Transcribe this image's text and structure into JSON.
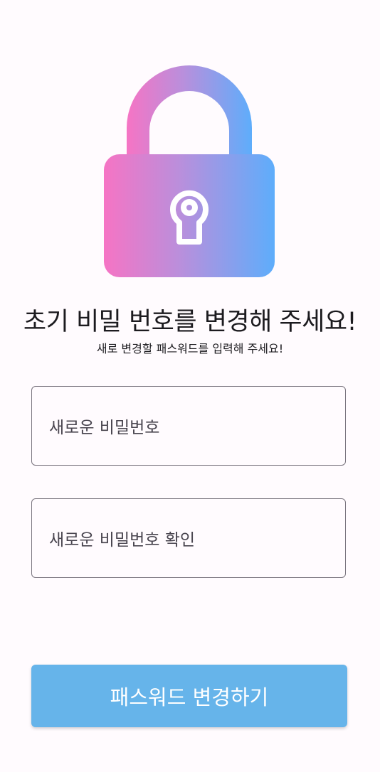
{
  "header": {
    "icon": "lock-icon",
    "gradient_start": "#f674c4",
    "gradient_end": "#5eadfb",
    "title": "초기 비밀 번호를 변경해 주세요!",
    "subtitle": "새로 변경할 패스워드를 입력해 주세요!"
  },
  "form": {
    "new_password": {
      "placeholder": "새로운 비밀번호",
      "value": ""
    },
    "confirm_password": {
      "placeholder": "새로운 비밀번호 확인",
      "value": ""
    },
    "submit_label": "패스워드 변경하기",
    "submit_color": "#66b4ea"
  }
}
